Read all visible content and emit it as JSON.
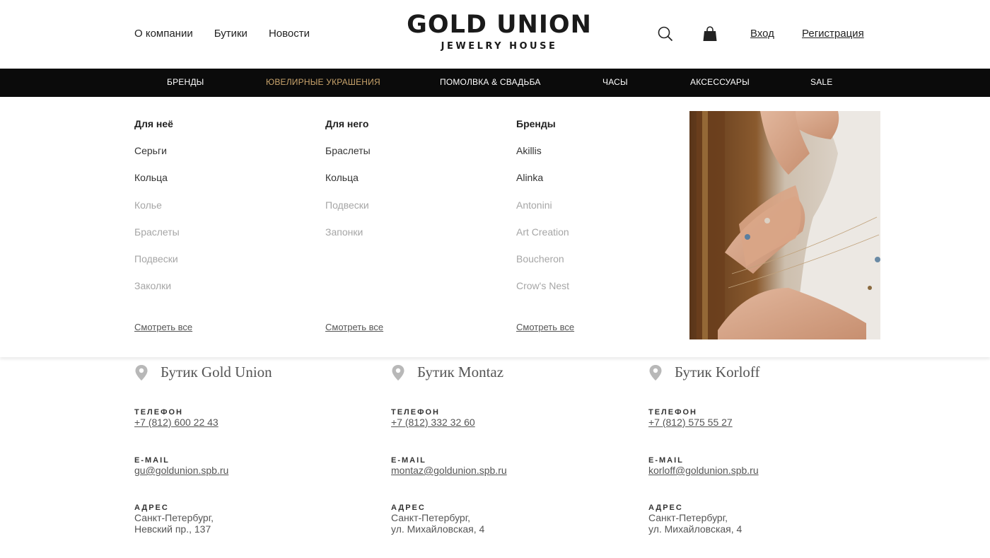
{
  "header": {
    "nav": [
      "О компании",
      "Бутики",
      "Новости"
    ],
    "logo_main": "GOLD UNION",
    "logo_sub": "JEWELRY HOUSE",
    "search_icon": "search-icon",
    "cart_icon": "shopping-bag-icon",
    "login": "Вход",
    "register": "Регистрация"
  },
  "categories": [
    "БРЕНДЫ",
    "ЮВЕЛИРНЫЕ УКРАШЕНИЯ",
    "ПОМОЛВКА & СВАДЬБА",
    "ЧАСЫ",
    "АКСЕССУАРЫ",
    "SALE"
  ],
  "active_category_color": "#c9a46c",
  "menu": {
    "col1": {
      "title": "Для неё",
      "items": [
        "Серьги",
        "Кольца",
        "Колье",
        "Браслеты",
        "Подвески",
        "Заколки"
      ],
      "see_all": "Смотреть все"
    },
    "col2": {
      "title": "Для него",
      "items": [
        "Браслеты",
        "Кольца",
        "Подвески",
        "Запонки"
      ],
      "see_all": "Смотреть все"
    },
    "col3": {
      "title": "Бренды",
      "items": [
        "Akillis",
        "Alinka",
        "Antonini",
        "Art Creation",
        "Boucheron",
        "Crow's Nest"
      ],
      "see_all": "Смотреть все"
    }
  },
  "labels": {
    "phone": "ТЕЛЕФОН",
    "email": "E-MAIL",
    "address": "АДРЕС"
  },
  "boutiques": [
    {
      "name": "Бутик Gold Union",
      "phone": "+7 (812) 600 22 43",
      "email": "gu@goldunion.spb.ru",
      "address_city": "Санкт-Петербург,",
      "address_street": "Невский пр., 137"
    },
    {
      "name": "Бутик Montaz",
      "phone": "+7 (812) 332 32 60",
      "email": "montaz@goldunion.spb.ru",
      "address_city": "Санкт-Петербург,",
      "address_street": "ул. Михайловская, 4"
    },
    {
      "name": "Бутик Korloff",
      "phone": "+7 (812) 575 55 27",
      "email": "korloff@goldunion.spb.ru",
      "address_city": "Санкт-Петербург,",
      "address_street": "ул. Михайловская, 4"
    }
  ]
}
